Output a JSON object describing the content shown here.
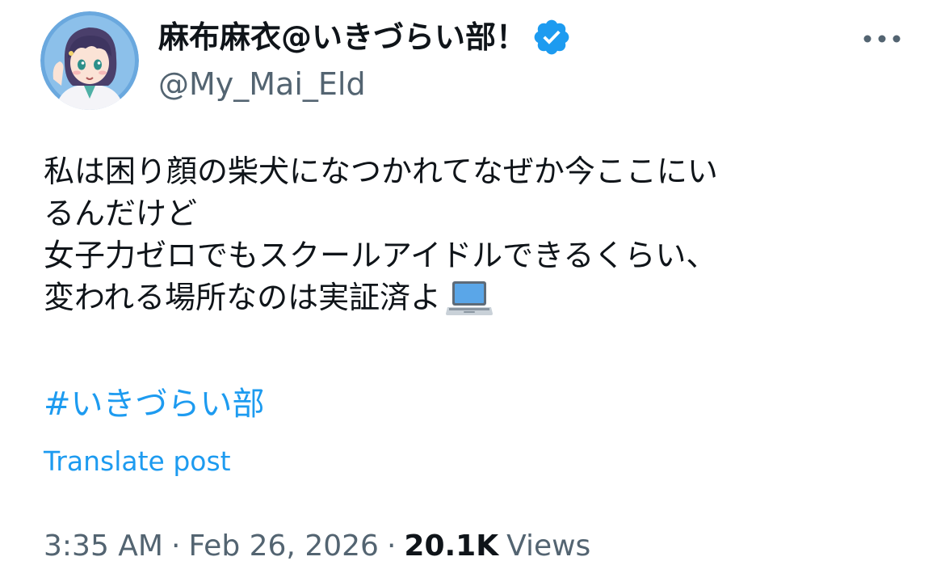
{
  "author": {
    "display_name": "麻布麻衣@いきづらい部！",
    "handle": "@My_Mai_Eld",
    "avatar_icon": "anime-girl-avatar",
    "verified_icon": "verified-badge-icon",
    "verified_color": "#1d9bf0"
  },
  "more_icon": "more-horizontal-icon",
  "post": {
    "lines": [
      "私は困り顔の柴犬になつかれてなぜか今ここにい",
      "るんだけど",
      "女子力ゼロでもスクールアイドルできるくらい、",
      "変われる場所なのは実証済よ"
    ],
    "emoji": "laptop-icon",
    "hashtag": "#いきづらい部",
    "translate_label": "Translate post"
  },
  "meta": {
    "time": "3:35 AM",
    "separator": "·",
    "date": "Feb 26, 2026",
    "views_count": "20.1K",
    "views_label": "Views"
  },
  "colors": {
    "link": "#1d9bf0",
    "secondary_text": "#536471",
    "primary_text": "#0f1419"
  }
}
